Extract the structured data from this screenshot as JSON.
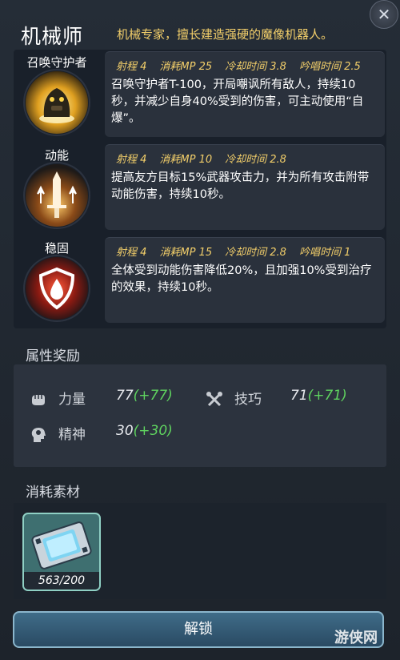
{
  "header": {
    "title": "机械师",
    "description": "机械专家，擅长建造强硬的魔像机器人。"
  },
  "skills": [
    {
      "name": "召唤守护者",
      "icon": "golem-summon-icon",
      "range": "射程 4",
      "mp": "消耗MP 25",
      "cooldown": "冷却时间 3.8",
      "cast": "吟唱时间 2.5",
      "desc": "召唤守护者T-100，开局嘲讽所有敌人，持续10秒，并减少自身40%受到的伤害，可主动使用“自爆”。"
    },
    {
      "name": "动能",
      "icon": "sword-buff-icon",
      "range": "射程 4",
      "mp": "消耗MP 10",
      "cooldown": "冷却时间 2.8",
      "cast": "",
      "desc": "提高友方目标15%武器攻击力，并为所有攻击附带动能伤害，持续10秒。"
    },
    {
      "name": "稳固",
      "icon": "shield-drop-icon",
      "range": "射程 4",
      "mp": "消耗MP 15",
      "cooldown": "冷却时间 2.8",
      "cast": "吟唱时间 1",
      "desc": "全体受到动能伤害降低20%，且加强10%受到治疗的效果，持续10秒。"
    }
  ],
  "attributes": {
    "title": "属性奖励",
    "items": [
      {
        "label": "力量",
        "value": "77",
        "bonus": "(+77)",
        "icon": "fist-icon"
      },
      {
        "label": "技巧",
        "value": "71",
        "bonus": "(+71)",
        "icon": "tools-icon"
      },
      {
        "label": "精神",
        "value": "30",
        "bonus": "(+30)",
        "icon": "mind-icon"
      }
    ]
  },
  "materials": {
    "title": "消耗素材",
    "items": [
      {
        "icon": "chip-card-icon",
        "count": "563/200"
      }
    ]
  },
  "unlock_label": "解锁",
  "watermark": "游侠网",
  "colors": {
    "accent_gold": "#f3cf6a",
    "bonus_green": "#5fd35f",
    "button_blue": "#3f6c88"
  }
}
